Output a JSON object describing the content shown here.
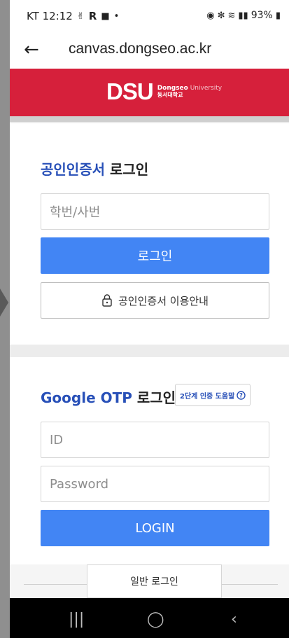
{
  "status_bar": {
    "carrier_time": "KT 12:12",
    "left_icons": "R",
    "battery": "93%"
  },
  "browser": {
    "url": "canvas.dongseo.ac.kr"
  },
  "banner": {
    "logo_text": "DSU",
    "logo_en_bold": "Dongseo",
    "logo_en_light": "University",
    "logo_ko": "동서대학교"
  },
  "cert_login": {
    "title_accent": "공인인증서",
    "title_rest": "로그인",
    "student_id_placeholder": "학번/사번",
    "login_button": "로그인",
    "guide_button": "공인인증서 이용안내"
  },
  "otp_login": {
    "title_accent": "Google OTP",
    "title_rest": "로그인",
    "help_button": "2단계 인증 도움말",
    "id_placeholder": "ID",
    "password_placeholder": "Password",
    "login_button": "LOGIN"
  },
  "general": {
    "login_button": "일반 로그인"
  },
  "colors": {
    "brand_red": "#d6203b",
    "primary_blue": "#4285f4",
    "title_blue": "#2850b8"
  }
}
